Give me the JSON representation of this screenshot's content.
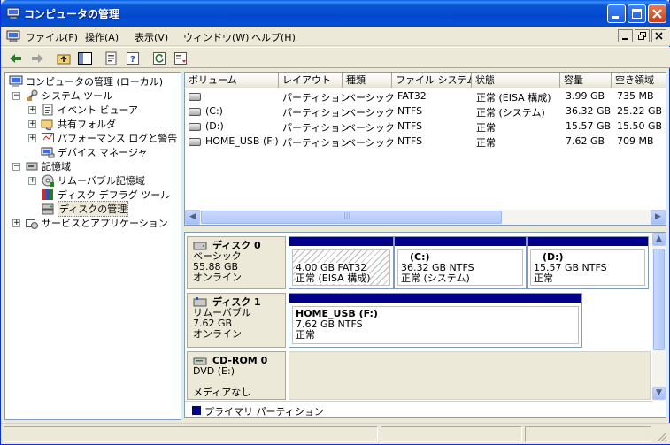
{
  "window": {
    "title": "コンピュータの管理",
    "accent": "#0a55d8"
  },
  "menu": {
    "items": [
      "ファイル(F)",
      "操作(A)",
      "表示(V)",
      "ウィンドウ(W)",
      "ヘルプ(H)"
    ]
  },
  "tree": {
    "items": [
      {
        "label": "コンピュータの管理 (ローカル)",
        "icon": "computer-icon"
      },
      {
        "label": "システム ツール",
        "icon": "tools-icon"
      },
      {
        "label": "イベント ビューア",
        "icon": "event-viewer-icon"
      },
      {
        "label": "共有フォルダ",
        "icon": "shared-folder-icon"
      },
      {
        "label": "パフォーマンス ログと警告",
        "icon": "performance-icon"
      },
      {
        "label": "デバイス マネージャ",
        "icon": "device-manager-icon"
      },
      {
        "label": "記憶域",
        "icon": "storage-icon"
      },
      {
        "label": "リムーバブル記憶域",
        "icon": "removable-storage-icon"
      },
      {
        "label": "ディスク デフラグ ツール",
        "icon": "defrag-icon"
      },
      {
        "label": "ディスクの管理",
        "icon": "disk-management-icon"
      },
      {
        "label": "サービスとアプリケーション",
        "icon": "services-icon"
      }
    ]
  },
  "volumes": {
    "columns": [
      "ボリューム",
      "レイアウト",
      "種類",
      "ファイル システム",
      "状態",
      "容量",
      "空き領域"
    ],
    "rows": [
      [
        "",
        "パーティション",
        "ベーシック",
        "FAT32",
        "正常 (EISA 構成)",
        "3.99 GB",
        "735 MB"
      ],
      [
        "(C:)",
        "パーティション",
        "ベーシック",
        "NTFS",
        "正常 (システム)",
        "36.32 GB",
        "25.22 GB"
      ],
      [
        "(D:)",
        "パーティション",
        "ベーシック",
        "NTFS",
        "正常",
        "15.57 GB",
        "15.50 GB"
      ],
      [
        "HOME_USB (F:)",
        "パーティション",
        "ベーシック",
        "NTFS",
        "正常",
        "7.62 GB",
        "709 MB"
      ]
    ],
    "scroll_thumb_char": "|||"
  },
  "disks": {
    "disk0": {
      "name": "ディスク 0",
      "type": "ベーシック",
      "size": "55.88 GB",
      "status": "オンライン",
      "partitions": [
        {
          "title": "",
          "size": "4.00 GB FAT32",
          "status": "正常 (EISA 構成)"
        },
        {
          "title": "(C:)",
          "size": "36.32 GB NTFS",
          "status": "正常 (システム)"
        },
        {
          "title": "(D:)",
          "size": "15.57 GB NTFS",
          "status": "正常"
        }
      ]
    },
    "disk1": {
      "name": "ディスク 1",
      "type": "リムーバブル",
      "size": "7.62 GB",
      "status": "オンライン",
      "partitions": [
        {
          "title": "HOME_USB (F:)",
          "size": "7.62 GB NTFS",
          "status": "正常"
        }
      ]
    },
    "cdrom0": {
      "name": "CD-ROM 0",
      "type": "DVD (E:)",
      "status": "メディアなし"
    },
    "legend": "プライマリ パーティション",
    "partition_color": "#00008b"
  }
}
